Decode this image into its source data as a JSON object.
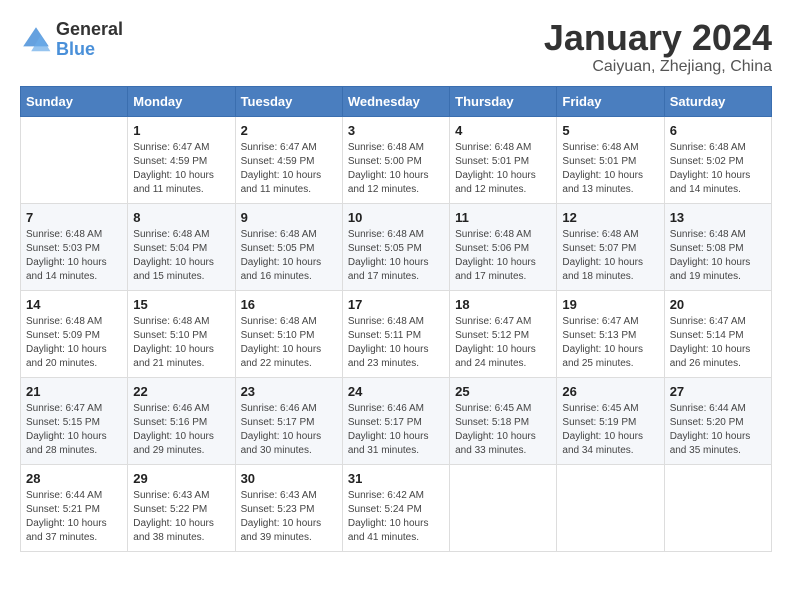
{
  "header": {
    "logo_general": "General",
    "logo_blue": "Blue",
    "month_title": "January 2024",
    "subtitle": "Caiyuan, Zhejiang, China"
  },
  "days_of_week": [
    "Sunday",
    "Monday",
    "Tuesday",
    "Wednesday",
    "Thursday",
    "Friday",
    "Saturday"
  ],
  "weeks": [
    [
      {
        "day": "",
        "info": ""
      },
      {
        "day": "1",
        "info": "Sunrise: 6:47 AM\nSunset: 4:59 PM\nDaylight: 10 hours\nand 11 minutes."
      },
      {
        "day": "2",
        "info": "Sunrise: 6:47 AM\nSunset: 4:59 PM\nDaylight: 10 hours\nand 11 minutes."
      },
      {
        "day": "3",
        "info": "Sunrise: 6:48 AM\nSunset: 5:00 PM\nDaylight: 10 hours\nand 12 minutes."
      },
      {
        "day": "4",
        "info": "Sunrise: 6:48 AM\nSunset: 5:01 PM\nDaylight: 10 hours\nand 12 minutes."
      },
      {
        "day": "5",
        "info": "Sunrise: 6:48 AM\nSunset: 5:01 PM\nDaylight: 10 hours\nand 13 minutes."
      },
      {
        "day": "6",
        "info": "Sunrise: 6:48 AM\nSunset: 5:02 PM\nDaylight: 10 hours\nand 14 minutes."
      }
    ],
    [
      {
        "day": "7",
        "info": "Sunrise: 6:48 AM\nSunset: 5:03 PM\nDaylight: 10 hours\nand 14 minutes."
      },
      {
        "day": "8",
        "info": "Sunrise: 6:48 AM\nSunset: 5:04 PM\nDaylight: 10 hours\nand 15 minutes."
      },
      {
        "day": "9",
        "info": "Sunrise: 6:48 AM\nSunset: 5:05 PM\nDaylight: 10 hours\nand 16 minutes."
      },
      {
        "day": "10",
        "info": "Sunrise: 6:48 AM\nSunset: 5:05 PM\nDaylight: 10 hours\nand 17 minutes."
      },
      {
        "day": "11",
        "info": "Sunrise: 6:48 AM\nSunset: 5:06 PM\nDaylight: 10 hours\nand 17 minutes."
      },
      {
        "day": "12",
        "info": "Sunrise: 6:48 AM\nSunset: 5:07 PM\nDaylight: 10 hours\nand 18 minutes."
      },
      {
        "day": "13",
        "info": "Sunrise: 6:48 AM\nSunset: 5:08 PM\nDaylight: 10 hours\nand 19 minutes."
      }
    ],
    [
      {
        "day": "14",
        "info": "Sunrise: 6:48 AM\nSunset: 5:09 PM\nDaylight: 10 hours\nand 20 minutes."
      },
      {
        "day": "15",
        "info": "Sunrise: 6:48 AM\nSunset: 5:10 PM\nDaylight: 10 hours\nand 21 minutes."
      },
      {
        "day": "16",
        "info": "Sunrise: 6:48 AM\nSunset: 5:10 PM\nDaylight: 10 hours\nand 22 minutes."
      },
      {
        "day": "17",
        "info": "Sunrise: 6:48 AM\nSunset: 5:11 PM\nDaylight: 10 hours\nand 23 minutes."
      },
      {
        "day": "18",
        "info": "Sunrise: 6:47 AM\nSunset: 5:12 PM\nDaylight: 10 hours\nand 24 minutes."
      },
      {
        "day": "19",
        "info": "Sunrise: 6:47 AM\nSunset: 5:13 PM\nDaylight: 10 hours\nand 25 minutes."
      },
      {
        "day": "20",
        "info": "Sunrise: 6:47 AM\nSunset: 5:14 PM\nDaylight: 10 hours\nand 26 minutes."
      }
    ],
    [
      {
        "day": "21",
        "info": "Sunrise: 6:47 AM\nSunset: 5:15 PM\nDaylight: 10 hours\nand 28 minutes."
      },
      {
        "day": "22",
        "info": "Sunrise: 6:46 AM\nSunset: 5:16 PM\nDaylight: 10 hours\nand 29 minutes."
      },
      {
        "day": "23",
        "info": "Sunrise: 6:46 AM\nSunset: 5:17 PM\nDaylight: 10 hours\nand 30 minutes."
      },
      {
        "day": "24",
        "info": "Sunrise: 6:46 AM\nSunset: 5:17 PM\nDaylight: 10 hours\nand 31 minutes."
      },
      {
        "day": "25",
        "info": "Sunrise: 6:45 AM\nSunset: 5:18 PM\nDaylight: 10 hours\nand 33 minutes."
      },
      {
        "day": "26",
        "info": "Sunrise: 6:45 AM\nSunset: 5:19 PM\nDaylight: 10 hours\nand 34 minutes."
      },
      {
        "day": "27",
        "info": "Sunrise: 6:44 AM\nSunset: 5:20 PM\nDaylight: 10 hours\nand 35 minutes."
      }
    ],
    [
      {
        "day": "28",
        "info": "Sunrise: 6:44 AM\nSunset: 5:21 PM\nDaylight: 10 hours\nand 37 minutes."
      },
      {
        "day": "29",
        "info": "Sunrise: 6:43 AM\nSunset: 5:22 PM\nDaylight: 10 hours\nand 38 minutes."
      },
      {
        "day": "30",
        "info": "Sunrise: 6:43 AM\nSunset: 5:23 PM\nDaylight: 10 hours\nand 39 minutes."
      },
      {
        "day": "31",
        "info": "Sunrise: 6:42 AM\nSunset: 5:24 PM\nDaylight: 10 hours\nand 41 minutes."
      },
      {
        "day": "",
        "info": ""
      },
      {
        "day": "",
        "info": ""
      },
      {
        "day": "",
        "info": ""
      }
    ]
  ]
}
